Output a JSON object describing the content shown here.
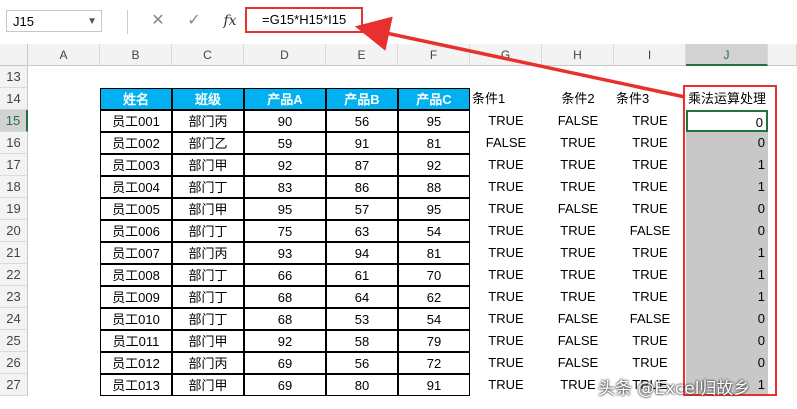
{
  "name_box": "J15",
  "formula": "=G15*H15*I15",
  "formula_icons": [
    "cancel-icon",
    "confirm-icon",
    "fx-icon"
  ],
  "columns": [
    "A",
    "B",
    "C",
    "D",
    "E",
    "F",
    "G",
    "H",
    "I",
    "J"
  ],
  "row_numbers": [
    "13",
    "14",
    "15",
    "16",
    "17",
    "18",
    "19",
    "20",
    "21",
    "22",
    "23",
    "24",
    "25",
    "26",
    "27"
  ],
  "headers": {
    "name": "姓名",
    "class": "班级",
    "a": "产品A",
    "b": "产品B",
    "c": "产品C",
    "cond1": "条件1",
    "cond2": "条件2",
    "cond3": "条件3",
    "result": "乘法运算处理"
  },
  "rows": [
    {
      "name": "员工001",
      "class": "部门丙",
      "a": "90",
      "b": "56",
      "c": "95",
      "c1": "TRUE",
      "c2": "FALSE",
      "c3": "TRUE",
      "r": "0"
    },
    {
      "name": "员工002",
      "class": "部门乙",
      "a": "59",
      "b": "91",
      "c": "81",
      "c1": "FALSE",
      "c2": "TRUE",
      "c3": "TRUE",
      "r": "0"
    },
    {
      "name": "员工003",
      "class": "部门甲",
      "a": "92",
      "b": "87",
      "c": "92",
      "c1": "TRUE",
      "c2": "TRUE",
      "c3": "TRUE",
      "r": "1"
    },
    {
      "name": "员工004",
      "class": "部门丁",
      "a": "83",
      "b": "86",
      "c": "88",
      "c1": "TRUE",
      "c2": "TRUE",
      "c3": "TRUE",
      "r": "1"
    },
    {
      "name": "员工005",
      "class": "部门甲",
      "a": "95",
      "b": "57",
      "c": "95",
      "c1": "TRUE",
      "c2": "FALSE",
      "c3": "TRUE",
      "r": "0"
    },
    {
      "name": "员工006",
      "class": "部门丁",
      "a": "75",
      "b": "63",
      "c": "54",
      "c1": "TRUE",
      "c2": "TRUE",
      "c3": "FALSE",
      "r": "0"
    },
    {
      "name": "员工007",
      "class": "部门丙",
      "a": "93",
      "b": "94",
      "c": "81",
      "c1": "TRUE",
      "c2": "TRUE",
      "c3": "TRUE",
      "r": "1"
    },
    {
      "name": "员工008",
      "class": "部门丁",
      "a": "66",
      "b": "61",
      "c": "70",
      "c1": "TRUE",
      "c2": "TRUE",
      "c3": "TRUE",
      "r": "1"
    },
    {
      "name": "员工009",
      "class": "部门丁",
      "a": "68",
      "b": "64",
      "c": "62",
      "c1": "TRUE",
      "c2": "TRUE",
      "c3": "TRUE",
      "r": "1"
    },
    {
      "name": "员工010",
      "class": "部门丁",
      "a": "68",
      "b": "53",
      "c": "54",
      "c1": "TRUE",
      "c2": "FALSE",
      "c3": "FALSE",
      "r": "0"
    },
    {
      "name": "员工011",
      "class": "部门甲",
      "a": "92",
      "b": "58",
      "c": "79",
      "c1": "TRUE",
      "c2": "FALSE",
      "c3": "TRUE",
      "r": "0"
    },
    {
      "name": "员工012",
      "class": "部门丙",
      "a": "69",
      "b": "56",
      "c": "72",
      "c1": "TRUE",
      "c2": "FALSE",
      "c3": "TRUE",
      "r": "0"
    },
    {
      "name": "员工013",
      "class": "部门甲",
      "a": "69",
      "b": "80",
      "c": "91",
      "c1": "TRUE",
      "c2": "TRUE",
      "c3": "TRUE",
      "r": "1"
    }
  ],
  "watermark": "头条 @Excel归故乡",
  "colors": {
    "header_fill": "#00b0f0",
    "highlight": "#e8302e",
    "selected": "#217346"
  }
}
